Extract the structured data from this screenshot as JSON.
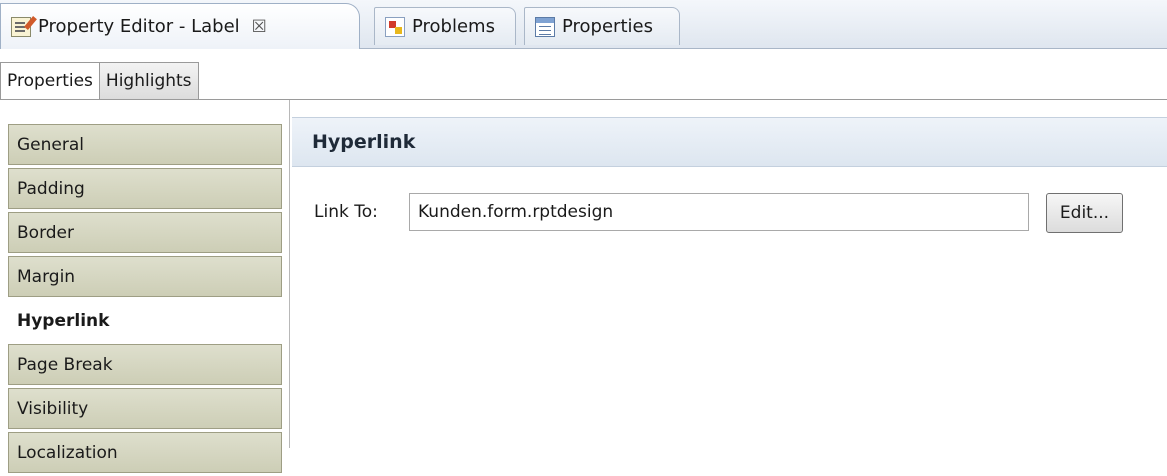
{
  "view_tabs": [
    {
      "label": "Property Editor - Label",
      "icon": "property-editor-icon",
      "close": "☒",
      "active": true
    },
    {
      "label": "Problems",
      "icon": "problems-icon",
      "active": false
    },
    {
      "label": "Properties",
      "icon": "properties-icon",
      "active": false
    }
  ],
  "sub_tabs": [
    {
      "label": "Properties",
      "active": true
    },
    {
      "label": "Highlights",
      "active": false
    }
  ],
  "categories": [
    {
      "label": "General"
    },
    {
      "label": "Padding"
    },
    {
      "label": "Border"
    },
    {
      "label": "Margin"
    },
    {
      "label": "Hyperlink",
      "selected": true
    },
    {
      "label": "Page Break"
    },
    {
      "label": "Visibility"
    },
    {
      "label": "Localization"
    }
  ],
  "section": {
    "title": "Hyperlink",
    "link_label": "Link To:",
    "link_value": "Kunden.form.rptdesign",
    "edit_button": "Edit..."
  },
  "colors": {
    "tab_bar": "#dfe6ef",
    "category_bg": "#cdceb6",
    "section_header": "#dde6f0"
  }
}
